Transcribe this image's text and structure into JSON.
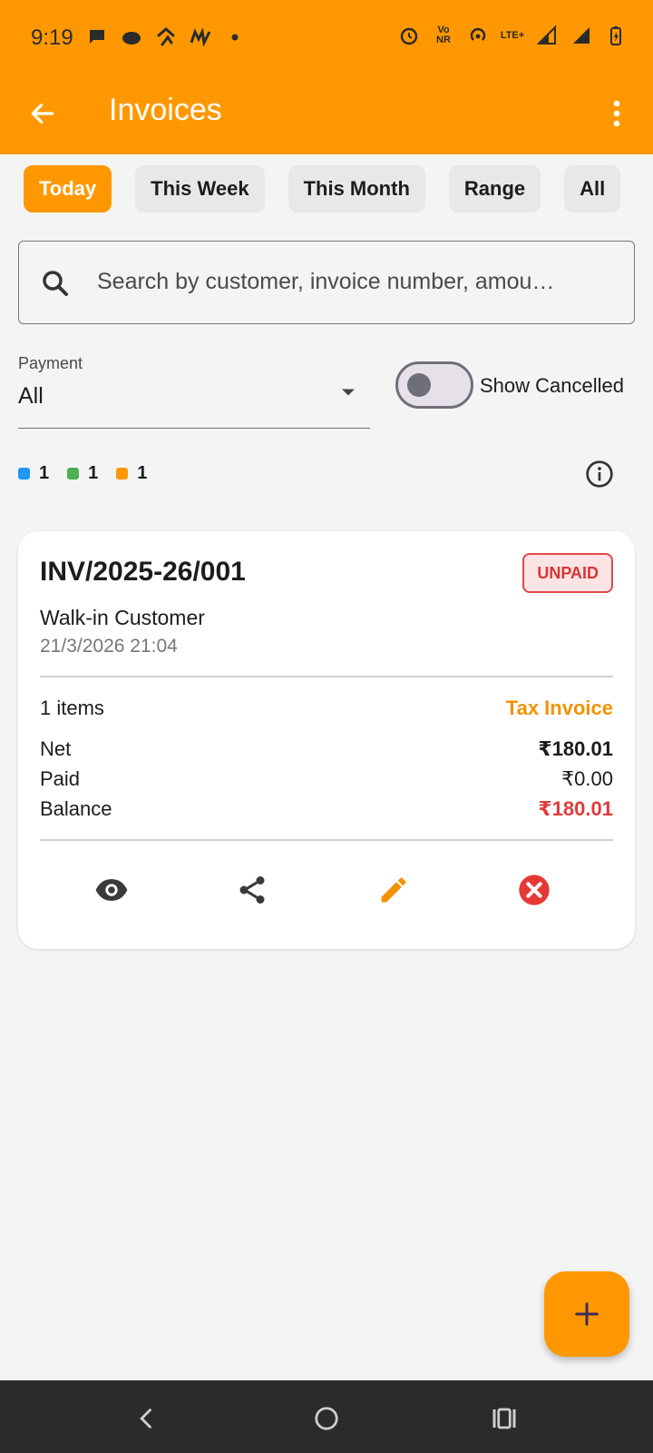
{
  "status_bar": {
    "time": "9:19",
    "left_icons": [
      "chat-bubble-icon",
      "cloud-icon",
      "app-icon",
      "myntra-icon",
      "dot-icon"
    ],
    "right_icons": [
      "alarm-icon",
      "volte-icon",
      "hotspot-icon",
      "lte-icon",
      "signal-icon",
      "signal-icon",
      "battery-icon"
    ],
    "volte_text": "Vo NR",
    "lte_text": "LTE+"
  },
  "app_bar": {
    "title": "Invoices"
  },
  "filters": {
    "chips": [
      {
        "label": "Today",
        "active": true
      },
      {
        "label": "This Week",
        "active": false
      },
      {
        "label": "This Month",
        "active": false
      },
      {
        "label": "Range",
        "active": false
      },
      {
        "label": "All",
        "active": false
      }
    ]
  },
  "search": {
    "placeholder": "Search by customer, invoice number, amou…"
  },
  "payment_filter": {
    "label": "Payment",
    "value": "All"
  },
  "show_cancelled": {
    "label": "Show Cancelled",
    "enabled": false
  },
  "legend": [
    {
      "color": "#2196f3",
      "count": "1"
    },
    {
      "color": "#4caf50",
      "count": "1"
    },
    {
      "color": "#ff9800",
      "count": "1"
    }
  ],
  "invoice": {
    "number": "INV/2025-26/001",
    "status": "UNPAID",
    "customer": "Walk-in Customer",
    "datetime": "21/3/2026  21:04",
    "items": "1 items",
    "type": "Tax Invoice",
    "net_label": "Net",
    "net_value": "₹180.01",
    "paid_label": "Paid",
    "paid_value": "₹0.00",
    "balance_label": "Balance",
    "balance_value": "₹180.01",
    "actions": [
      "eye-icon",
      "share-icon",
      "pencil-icon",
      "cancel-circle-icon"
    ]
  },
  "colors": {
    "primary": "#ff9800",
    "danger": "#e23a3a",
    "surface": "#ffffff",
    "background": "#f4f4f5"
  }
}
